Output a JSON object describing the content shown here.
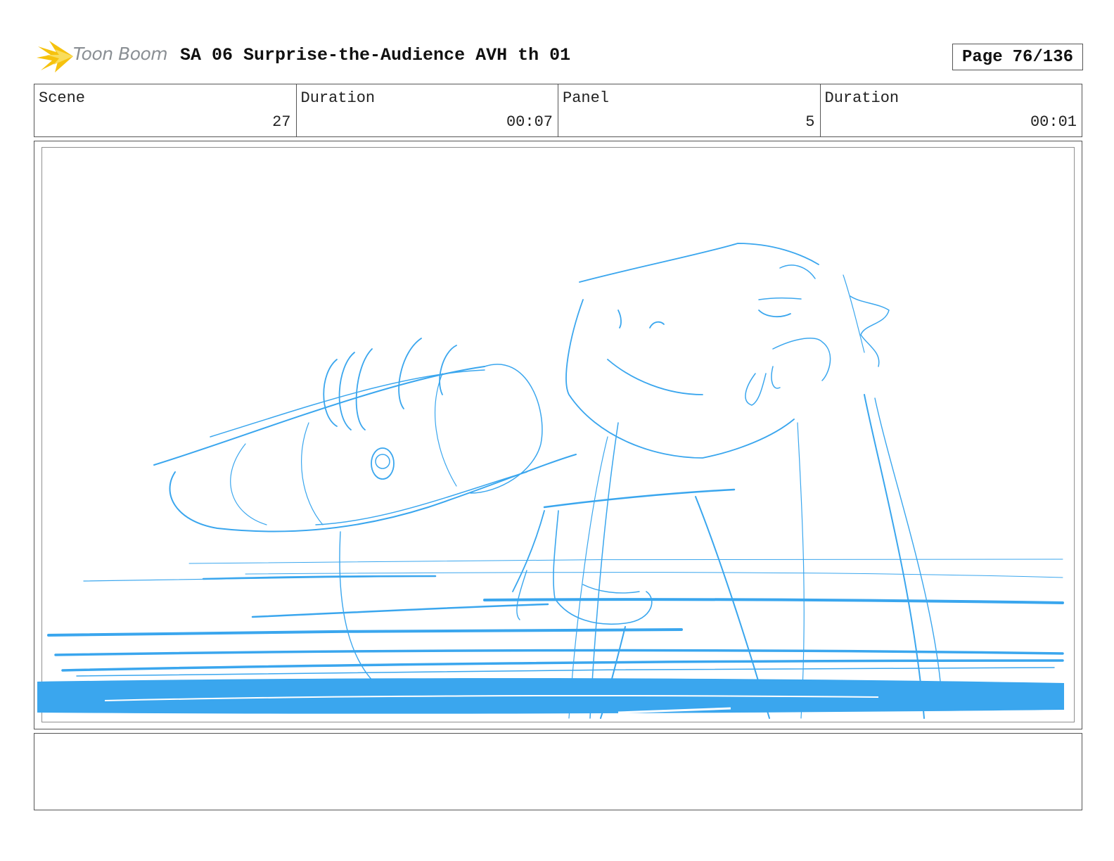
{
  "header": {
    "logo_text": "Toon Boom",
    "title": "SA 06 Surprise-the-Audience AVH th 01",
    "page_label": "Page",
    "page_value": "76/136"
  },
  "info": {
    "scene_label": "Scene",
    "scene_value": "27",
    "scene_duration_label": "Duration",
    "scene_duration_value": "00:07",
    "panel_label": "Panel",
    "panel_value": "5",
    "panel_duration_label": "Duration",
    "panel_duration_value": "00:01"
  },
  "panel": {
    "sketch_color": "#3aa6ee",
    "sketch_icon": "storyboard-sketch"
  },
  "notes": {
    "text": ""
  }
}
